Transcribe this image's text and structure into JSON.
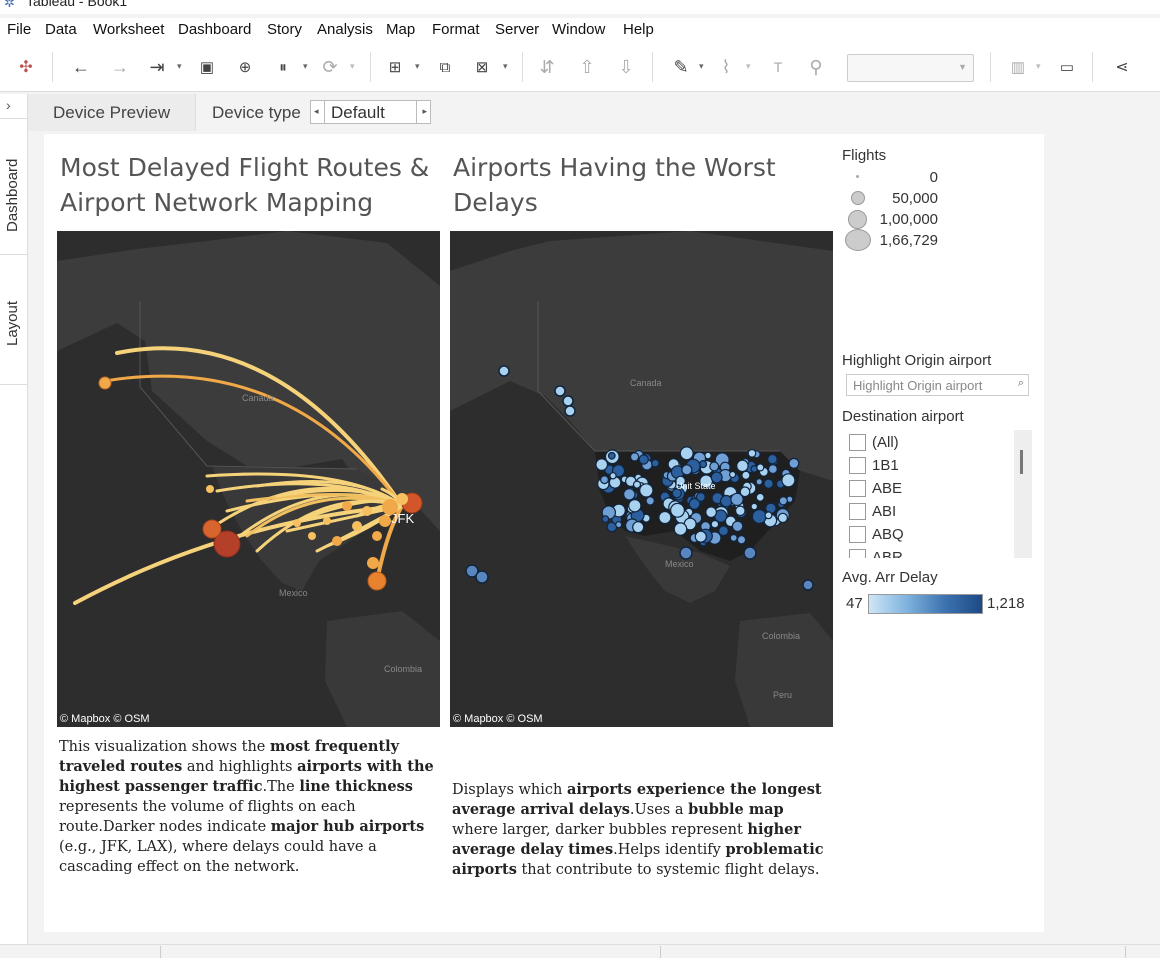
{
  "window": {
    "title": "Tableau - Book1"
  },
  "menu": [
    "File",
    "Data",
    "Worksheet",
    "Dashboard",
    "Story",
    "Analysis",
    "Map",
    "Format",
    "Server",
    "Window",
    "Help"
  ],
  "toolbar": {
    "icons": [
      "tableau-logo-icon",
      "undo-icon",
      "redo-icon",
      "replay-icon",
      "save-icon",
      "new-datasource-icon",
      "pause-updates-icon",
      "refresh-icon",
      "new-worksheet-icon",
      "duplicate-icon",
      "clear-icon",
      "swap-icon",
      "sort-ascending-icon",
      "sort-descending-icon",
      "highlight-icon",
      "group-icon",
      "label-icon",
      "pin-icon",
      "show-me-icon",
      "presentation-icon",
      "share-icon"
    ]
  },
  "sidebar": {
    "tabs": [
      "Dashboard",
      "Layout"
    ]
  },
  "device_bar": {
    "preview_label": "Device Preview",
    "type_label": "Device type",
    "type_value": "Default"
  },
  "dashboard": {
    "left": {
      "title_line1": "Most Delayed Flight Routes &",
      "title_line2": "Airport Network Mapping",
      "jfk_label": "JFK",
      "attribution": "© Mapbox © OSM",
      "labels": {
        "canada": "Canada",
        "mexico": "Mexico",
        "colombia": "Colombia"
      },
      "desc": {
        "p1": "This visualization shows the ",
        "b1": "most frequently traveled routes",
        "p2": " and highlights ",
        "b2": "airports with the highest passenger traffic",
        "p3": ".The ",
        "b3": "line thickness",
        "p4": " represents the volume of flights on each route.Darker nodes indicate ",
        "b4": "major hub airports",
        "p5": " (e.g., JFK, LAX), where delays could have a cascading effect on the network."
      }
    },
    "right": {
      "title_line1": "Airports Having the Worst",
      "title_line2": "Delays",
      "attribution": "© Mapbox © OSM",
      "labels": {
        "canada": "Canada",
        "us": "Unit State",
        "mexico": "Mexico",
        "colombia": "Colombia",
        "peru": "Peru"
      },
      "desc": {
        "p1": "Displays which ",
        "b1": "airports experience the longest average arrival delays",
        "p2": ".Uses a ",
        "b2": "bubble map",
        "p3": " where larger, darker bubbles represent ",
        "b3": "higher average delay times",
        "p4": ".Helps identify ",
        "b4": "problematic airports",
        "p5": " that contribute to systemic flight delays."
      }
    }
  },
  "legend_flights": {
    "title": "Flights",
    "values": [
      "0",
      "50,000",
      "1,00,000",
      "1,66,729"
    ]
  },
  "highlight_origin": {
    "title": "Highlight Origin airport",
    "placeholder": "Highlight Origin airport"
  },
  "destination_filter": {
    "title": "Destination airport",
    "items": [
      "(All)",
      "1B1",
      "ABE",
      "ABI",
      "ABQ",
      "ABR"
    ]
  },
  "avg_delay": {
    "title": "Avg. Arr Delay",
    "min": "47",
    "max": "1,218"
  },
  "colors": {
    "route_light": "#f6d37a",
    "route_mid": "#f0a848",
    "route_dark": "#d2562a",
    "bubble_light": "#a9d1f0",
    "bubble_dark": "#2c5f9e",
    "map_bg": "#2d2d2d"
  }
}
